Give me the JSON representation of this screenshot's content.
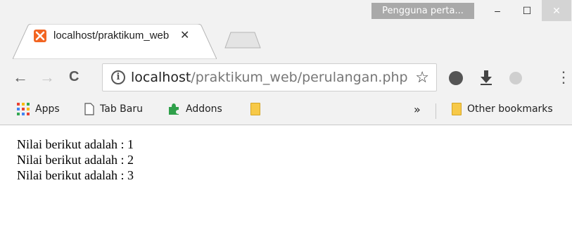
{
  "window": {
    "profile_label": "Pengguna perta...",
    "minimize_glyph": "‒",
    "maximize_glyph": "☐",
    "close_glyph": "✕"
  },
  "tab": {
    "title": "localhost/praktikum_web",
    "close_glyph": "✕",
    "favicon": "xampp-icon"
  },
  "toolbar": {
    "back_glyph": "←",
    "forward_glyph": "→",
    "reload_glyph": "C",
    "info_glyph": "i",
    "url_host": "localhost",
    "url_path": "/praktikum_web/perulangan.php",
    "star_glyph": "☆",
    "menu_glyph": "⋮"
  },
  "bookmarks": {
    "apps": "Apps",
    "tab_baru": "Tab Baru",
    "addons": "Addons",
    "more_glyph": "»",
    "other": "Other bookmarks"
  },
  "content": {
    "lines": [
      "Nilai berikut adalah : 1",
      "Nilai berikut adalah : 2",
      "Nilai berikut adalah : 3"
    ]
  }
}
